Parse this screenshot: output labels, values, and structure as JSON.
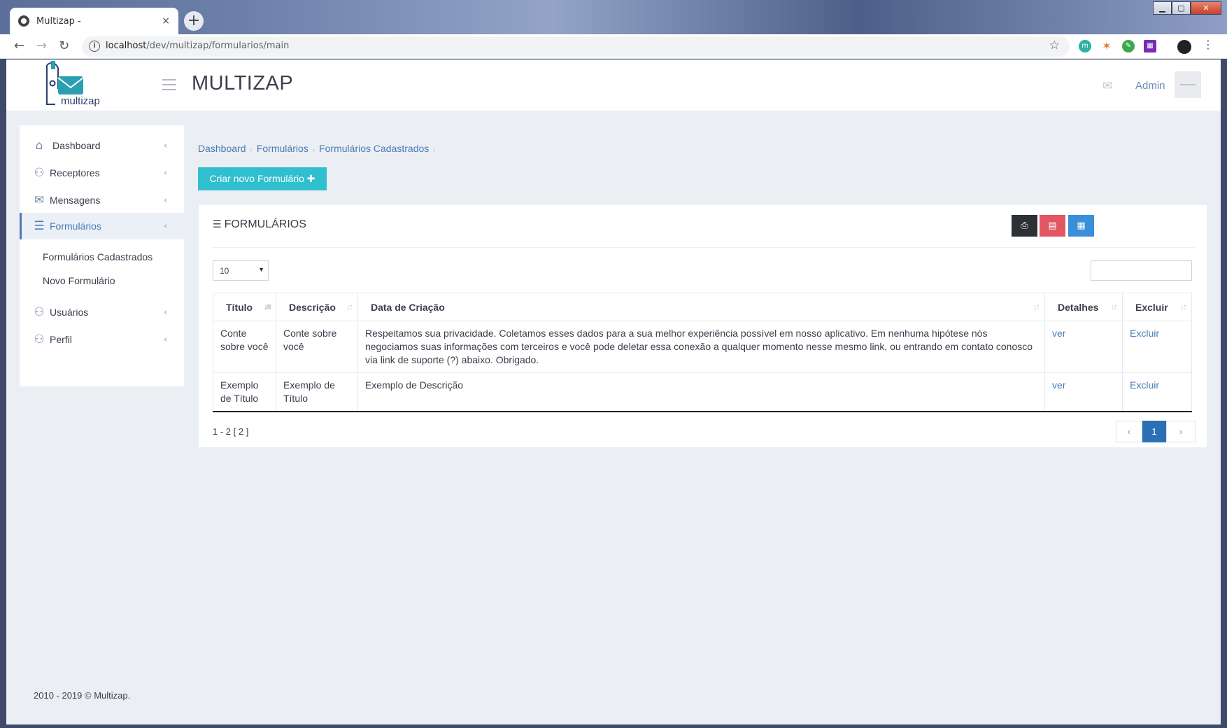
{
  "browser": {
    "tab_title": "Multizap -",
    "tab_close": "×",
    "new_tab": "+",
    "url_host": "localhost",
    "url_path": "/dev/multizap/formularios/main",
    "window_buttons": {
      "minimize": "▁",
      "maximize": "▢",
      "close": "✕"
    }
  },
  "header": {
    "logo_text": "multizap",
    "app_title": "MULTIZAP",
    "user_name": "Admin"
  },
  "sidebar": {
    "items": [
      {
        "label": "Dashboard",
        "icon": "home-icon"
      },
      {
        "label": "Receptores",
        "icon": "users-icon"
      },
      {
        "label": "Mensagens",
        "icon": "envelope-icon"
      },
      {
        "label": "Formulários",
        "icon": "list-icon",
        "active": true
      },
      {
        "label": "Usuários",
        "icon": "user-icon"
      },
      {
        "label": "Perfil",
        "icon": "user-icon"
      }
    ],
    "sub_items": [
      {
        "label": "Formulários Cadastrados"
      },
      {
        "label": "Novo Formulário"
      }
    ]
  },
  "breadcrumb": [
    "Dashboard",
    "Formulários",
    "Formulários Cadastrados"
  ],
  "actions": {
    "new_form_label": "Criar novo Formulário",
    "new_form_plus": "✚"
  },
  "panel": {
    "title": "FORMULÁRIOS",
    "page_size": "10",
    "export_buttons": [
      {
        "icon": "print-icon",
        "color": "#2d3136"
      },
      {
        "icon": "pdf-icon",
        "color": "#e25563"
      },
      {
        "icon": "excel-icon",
        "color": "#3b8fd8"
      }
    ]
  },
  "table": {
    "columns": [
      "Título",
      "Descrição",
      "Data de Criação",
      "Detalhes",
      "Excluir"
    ],
    "rows": [
      {
        "titulo": "Conte sobre você",
        "descricao": "Conte sobre você",
        "data": "Respeitamos sua privacidade. Coletamos esses dados para a sua melhor experiência possível em nosso aplicativo. Em nenhuma hipótese nós negociamos suas informações com terceiros e você pode deletar essa conexão a qualquer momento nesse mesmo link, ou entrando em contato conosco via link de suporte (?) abaixo. Obrigado.",
        "detalhes": "ver",
        "excluir": "Excluir"
      },
      {
        "titulo": "Exemplo de Título",
        "descricao": "Exemplo de Título",
        "data": "Exemplo de Descrição",
        "detalhes": "ver",
        "excluir": "Excluir"
      }
    ]
  },
  "pagination": {
    "range": "1 - 2 [ 2 ]",
    "prev": "‹",
    "current": "1",
    "next": "›"
  },
  "footer": {
    "text": "2010 - 2019 © Multizap."
  }
}
